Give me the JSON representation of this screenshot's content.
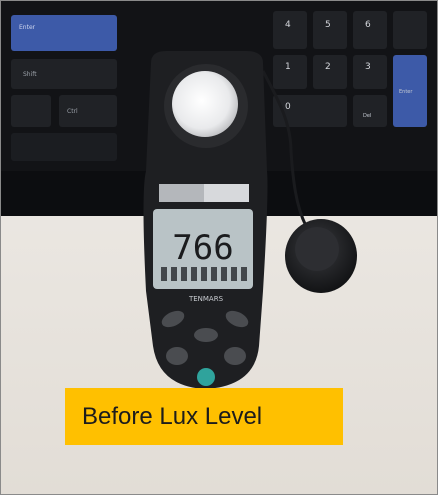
{
  "caption": {
    "text": "Before Lux Level"
  },
  "meter": {
    "reading": "766",
    "brand": "TENMARS"
  },
  "keyboard": {
    "keys": [
      "Enter",
      "Shift",
      "Ctrl",
      "4",
      "5",
      "6",
      "1",
      "2",
      "3",
      "0",
      "Del",
      "Enter"
    ]
  },
  "colors": {
    "caption_bg": "#ffc000",
    "enter_key": "#3d5aa8",
    "meter_body": "#1e1f22",
    "lcd": "#b9c3c6"
  },
  "icons": [
    "light-sensor-icon",
    "probe-cable-icon"
  ]
}
